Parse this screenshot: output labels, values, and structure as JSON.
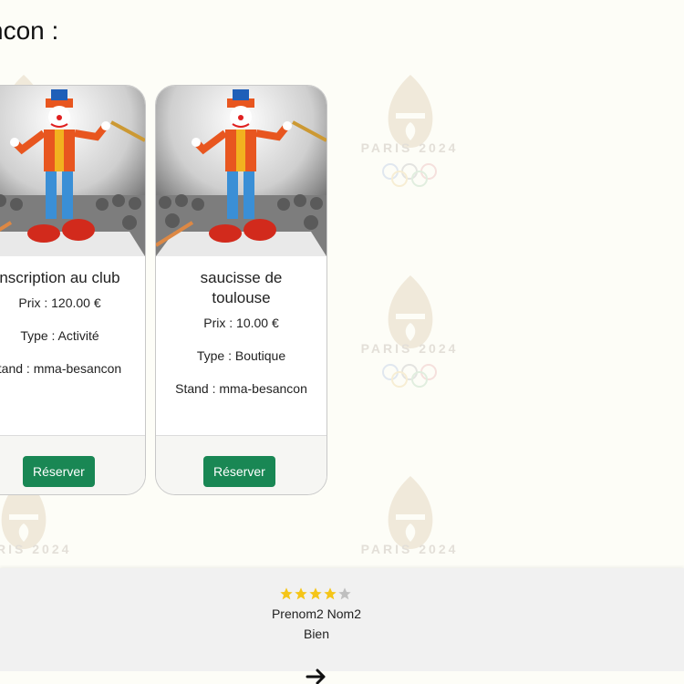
{
  "page": {
    "title_fragment": "ncon :"
  },
  "watermark": {
    "text": "PARIS 2024"
  },
  "cards": [
    {
      "title": "nscription au club",
      "price": "Prix : 120.00 €",
      "type": "Type : Activité",
      "stand": "tand : mma-besancon",
      "button": "Réserver"
    },
    {
      "title": "saucisse de toulouse",
      "price": "Prix : 10.00 €",
      "type": "Type : Boutique",
      "stand": "Stand : mma-besancon",
      "button": "Réserver"
    }
  ],
  "review": {
    "rating": 4,
    "max_rating": 5,
    "reviewer": "Prenom2 Nom2",
    "comment": "Bien"
  },
  "colors": {
    "accent": "#198754",
    "star_filled": "#f5c518",
    "star_empty": "#bfbfbf"
  },
  "icons": {
    "next": "arrow-right-icon"
  }
}
